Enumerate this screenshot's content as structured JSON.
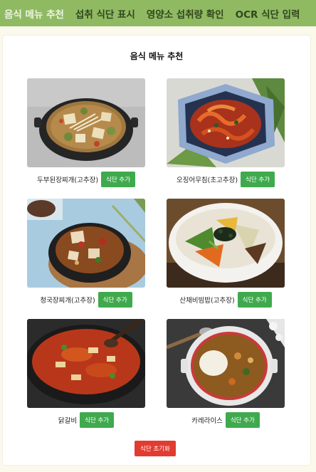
{
  "nav": {
    "tabs": [
      {
        "label": "음식 메뉴 추천"
      },
      {
        "label": "섭취 식단 표시"
      },
      {
        "label": "영양소 섭취량 확인"
      },
      {
        "label": "OCR 식단 입력"
      }
    ]
  },
  "main": {
    "title": "음식 메뉴 추천",
    "add_label": "식단 추가",
    "reset_label": "식단 초기화",
    "foods": [
      {
        "name": "두부된장찌개(고추장)",
        "icon": "stew-photo"
      },
      {
        "name": "오징어무침(초고추장)",
        "icon": "squid-salad-photo"
      },
      {
        "name": "청국장찌개(고추장)",
        "icon": "stew-photo"
      },
      {
        "name": "산채비빔밥(고추장)",
        "icon": "bibimbap-photo"
      },
      {
        "name": "닭갈비",
        "icon": "dakgalbi-photo"
      },
      {
        "name": "카레라이스",
        "icon": "curry-rice-photo"
      }
    ]
  },
  "colors": {
    "nav_bg": "#8fba62",
    "add_button": "#3faa4d",
    "reset_button": "#e23b30",
    "page_bg": "#fbf9ec"
  }
}
